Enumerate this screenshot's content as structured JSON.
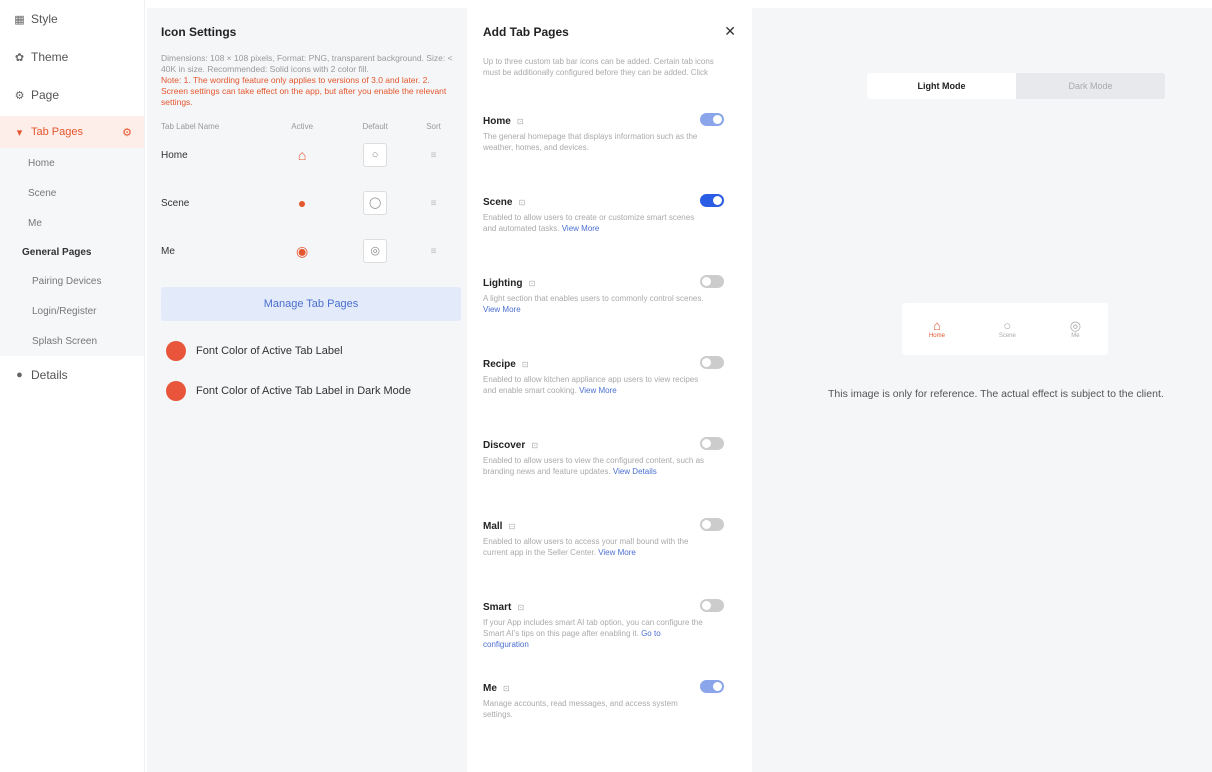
{
  "nav": {
    "style": "Style",
    "theme": "Theme",
    "page": "Page",
    "tab_pages": "Tab Pages",
    "tabs": [
      "Home",
      "Scene",
      "Me"
    ],
    "general_pages": "General Pages",
    "general": [
      "Pairing Devices",
      "Login/Register",
      "Splash Screen"
    ],
    "details": "Details"
  },
  "icon_settings": {
    "title": "Icon Settings",
    "desc": "Dimensions: 108 × 108 pixels, Format: PNG, transparent background. Size: < 40K in size. Recommended: Solid icons with 2 color fill.",
    "warn": "Note: 1. The wording feature only applies to versions of 3.0 and later. 2. Screen settings can take effect on the app, but after you enable the relevant settings.",
    "headers": [
      "Tab Label Name",
      "Active",
      "Default",
      "Sort"
    ],
    "rows": [
      {
        "name": "Home",
        "active": "⌂",
        "default": "○",
        "sort": "≡"
      },
      {
        "name": "Scene",
        "active": "●",
        "default": "◯",
        "sort": "≡"
      },
      {
        "name": "Me",
        "active": "◉",
        "default": "◎",
        "sort": "≡"
      }
    ],
    "manage_button": "Manage Tab Pages",
    "color1": "Font Color of Active Tab Label",
    "color2": "Font Color of Active Tab Label in Dark Mode",
    "accent": "#e8553b"
  },
  "add_tab_pages": {
    "title": "Add Tab Pages",
    "close": "✕",
    "desc": "Up to three custom tab bar icons can be added. Certain tab icons must be additionally configured before they can be added. Click",
    "items": [
      {
        "name": "Home",
        "desc": "The general homepage that displays information such as the weather, homes, and devices.",
        "link": "",
        "state": "on"
      },
      {
        "name": "Scene",
        "desc": "Enabled to allow users to create or customize smart scenes and automated tasks.",
        "link": "View More",
        "state": "on-strong"
      },
      {
        "name": "Lighting",
        "desc": "A light section that enables users to commonly control scenes.",
        "link": "View More",
        "state": "off"
      },
      {
        "name": "Recipe",
        "desc": "Enabled to allow kitchen appliance app users to view recipes and enable smart cooking.",
        "link": "View More",
        "state": "off"
      },
      {
        "name": "Discover",
        "desc": "Enabled to allow users to view the configured content, such as branding news and feature updates.",
        "link": "View Details",
        "state": "off"
      },
      {
        "name": "Mall",
        "desc": "Enabled to allow users to access your mall bound with the current app in the Seller Center.",
        "link": "View More",
        "state": "off"
      },
      {
        "name": "Smart",
        "desc": "If your App includes smart AI tab option, you can configure the Smart AI's tips on this page after enabling it.",
        "link": "Go to configuration",
        "state": "off"
      },
      {
        "name": "Me",
        "desc": "Manage accounts, read messages, and access system settings.",
        "link": "",
        "state": "on"
      }
    ]
  },
  "preview": {
    "light": "Light Mode",
    "dark": "Dark Mode",
    "tabbar": [
      {
        "label": "Home",
        "glyph": "⌂"
      },
      {
        "label": "Scene",
        "glyph": "○"
      },
      {
        "label": "Me",
        "glyph": "◎"
      }
    ],
    "note": "This image is only for reference. The actual effect is subject to the client."
  }
}
